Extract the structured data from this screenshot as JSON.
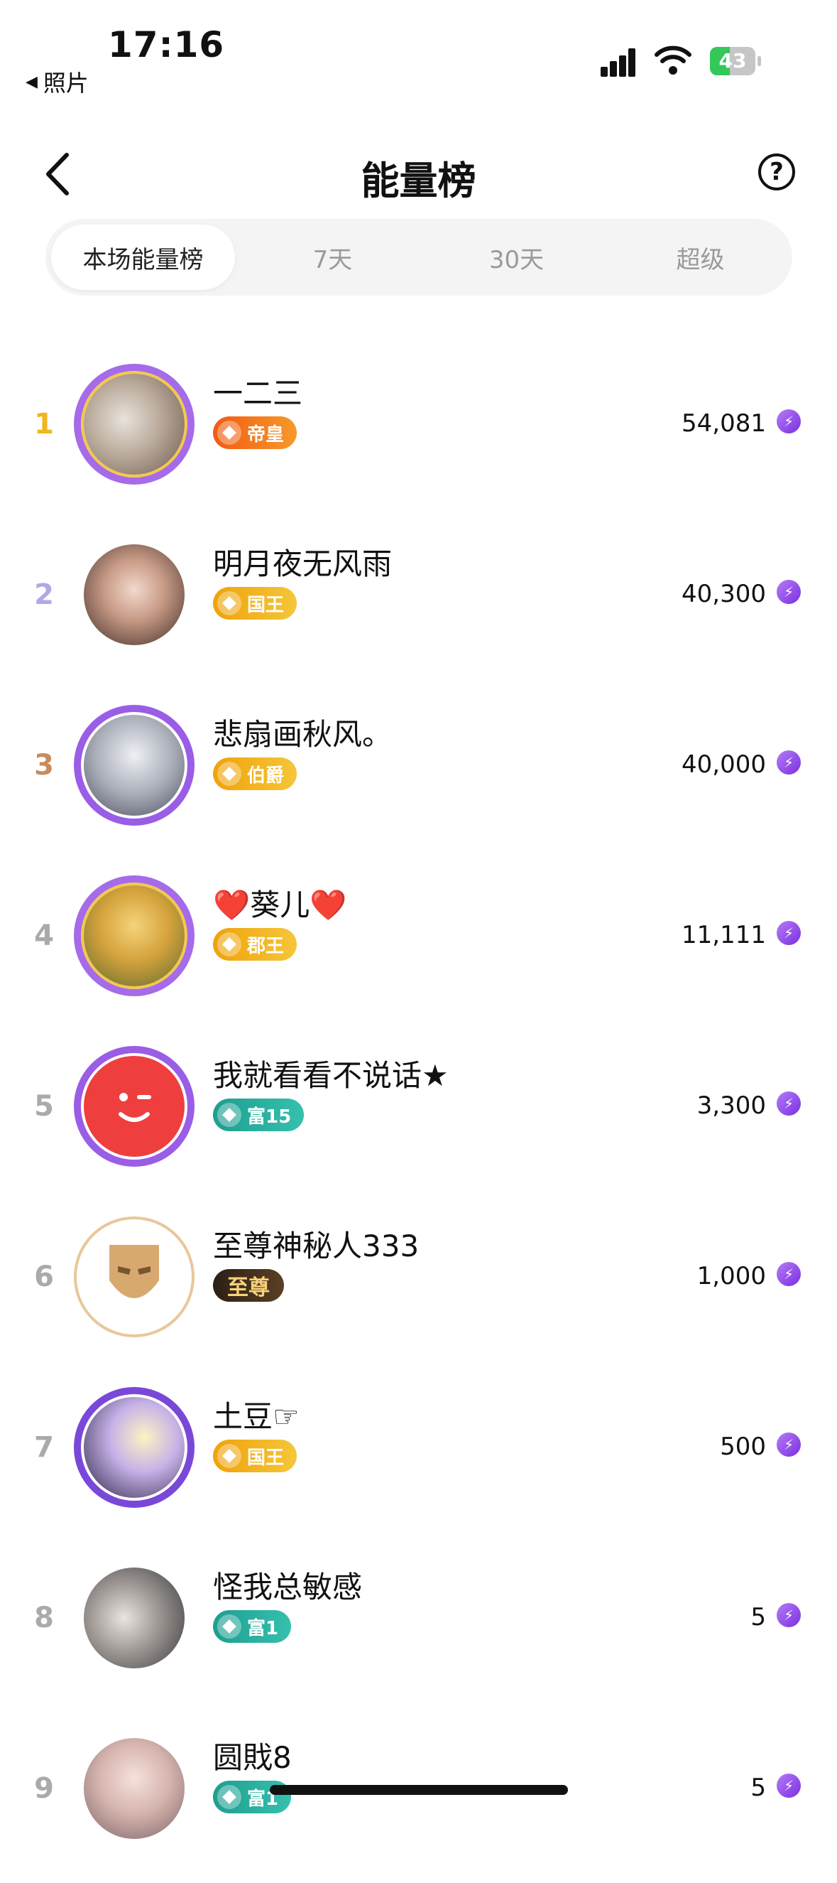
{
  "status_bar": {
    "time": "17:16",
    "back_app": "照片",
    "battery": "43"
  },
  "nav": {
    "title": "能量榜"
  },
  "tabs": [
    "本场能量榜",
    "7天",
    "30天",
    "超级"
  ],
  "list": [
    {
      "rank": "1",
      "name": "一二三",
      "badge": "帝皇",
      "score": "54,081",
      "badge_color": "#f26b1d"
    },
    {
      "rank": "2",
      "name": "明月夜无风雨",
      "badge": "国王",
      "score": "40,300",
      "badge_color": "#f0a70c"
    },
    {
      "rank": "3",
      "name": "悲扇画秋风。",
      "badge": "伯爵",
      "score": "40,000",
      "badge_color": "#f0a70c"
    },
    {
      "rank": "4",
      "name": "❤️葵儿❤️",
      "badge": "郡王",
      "score": "11,111",
      "badge_color": "#f0a70c"
    },
    {
      "rank": "5",
      "name": "我就看看不说话★",
      "badge": "富15",
      "score": "3,300",
      "badge_color": "#23a89a"
    },
    {
      "rank": "6",
      "name": "至尊神秘人333",
      "badge": "至尊",
      "score": "1,000",
      "badge_color": "#3a2a1c"
    },
    {
      "rank": "7",
      "name": "土豆☞",
      "badge": "国王",
      "score": "500",
      "badge_color": "#f0a70c"
    },
    {
      "rank": "8",
      "name": "怪我总敏感",
      "badge": "富1",
      "score": "5",
      "badge_color": "#23a89a"
    },
    {
      "rank": "9",
      "name": "圆戝8",
      "badge": "富1",
      "score": "5",
      "badge_color": "#23a89a"
    }
  ]
}
